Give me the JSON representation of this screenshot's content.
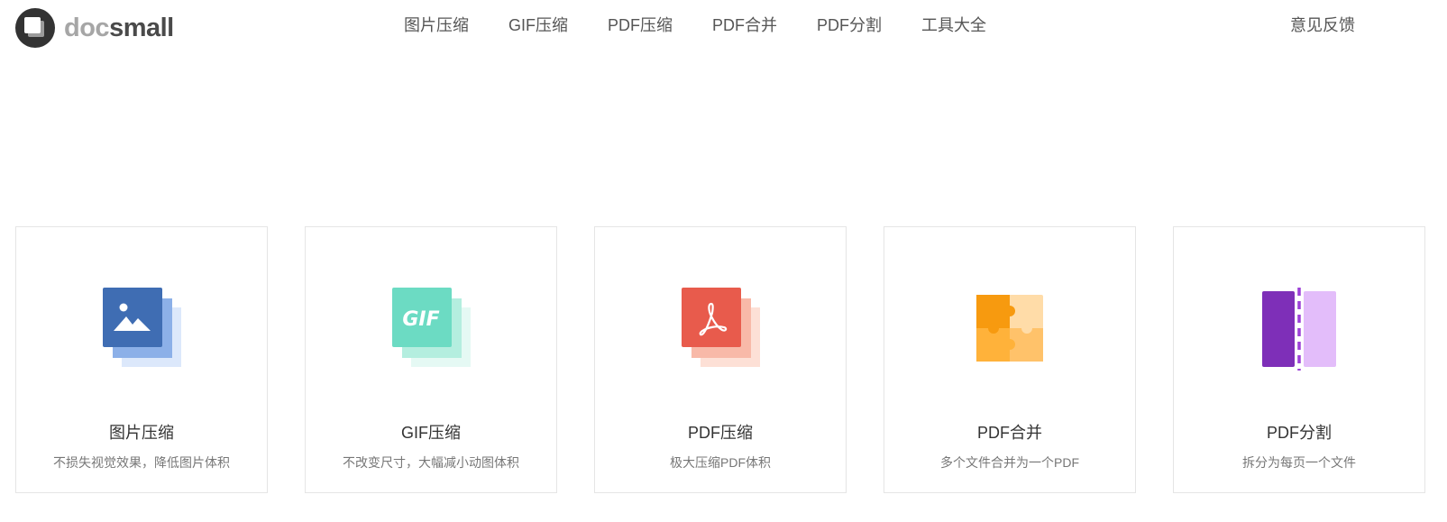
{
  "brand": {
    "logo_left": "doc",
    "logo_right": "small"
  },
  "nav": {
    "items": [
      {
        "label": "图片压缩"
      },
      {
        "label": "GIF压缩"
      },
      {
        "label": "PDF压缩"
      },
      {
        "label": "PDF合并"
      },
      {
        "label": "PDF分割"
      },
      {
        "label": "工具大全"
      }
    ],
    "feedback": "意见反馈"
  },
  "tools": [
    {
      "title": "图片压缩",
      "desc": "不损失视觉效果，降低图片体积",
      "icon": "image-stack-icon",
      "color": "#3f6db3"
    },
    {
      "title": "GIF压缩",
      "desc": "不改变尺寸，大幅减小动图体积",
      "icon": "gif-stack-icon",
      "color": "#6cdbc3",
      "icon_text": "GIF"
    },
    {
      "title": "PDF压缩",
      "desc": "极大压缩PDF体积",
      "icon": "pdf-stack-icon",
      "color": "#e85b4c"
    },
    {
      "title": "PDF合并",
      "desc": "多个文件合并为一个PDF",
      "icon": "puzzle-icon",
      "color": "#f79a0f"
    },
    {
      "title": "PDF分割",
      "desc": "拆分为每页一个文件",
      "icon": "split-pages-icon",
      "color": "#7e2fb8"
    }
  ]
}
